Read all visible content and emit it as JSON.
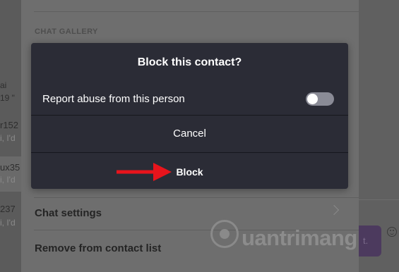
{
  "background": {
    "chat_list": [
      {
        "name": "",
        "preview": "ai",
        "extra": "19  \""
      },
      {
        "name": "r152",
        "preview": "i, I'd"
      },
      {
        "name": "ux35",
        "preview": "i, I'd"
      },
      {
        "name": "237",
        "preview": "i, I'd"
      }
    ],
    "panel": {
      "section_header": "CHAT GALLERY",
      "chat_settings": "Chat settings",
      "remove_contact": "Remove from contact list"
    },
    "purple_button_text": "t."
  },
  "dialog": {
    "title": "Block this contact?",
    "report_label": "Report abuse from this person",
    "report_toggle_on": false,
    "cancel_label": "Cancel",
    "block_label": "Block"
  },
  "watermark": {
    "text": "uantrimang"
  },
  "colors": {
    "dialog_bg": "#2b2c36",
    "arrow": "#e8141c",
    "overlay": "#5e5e5e"
  }
}
